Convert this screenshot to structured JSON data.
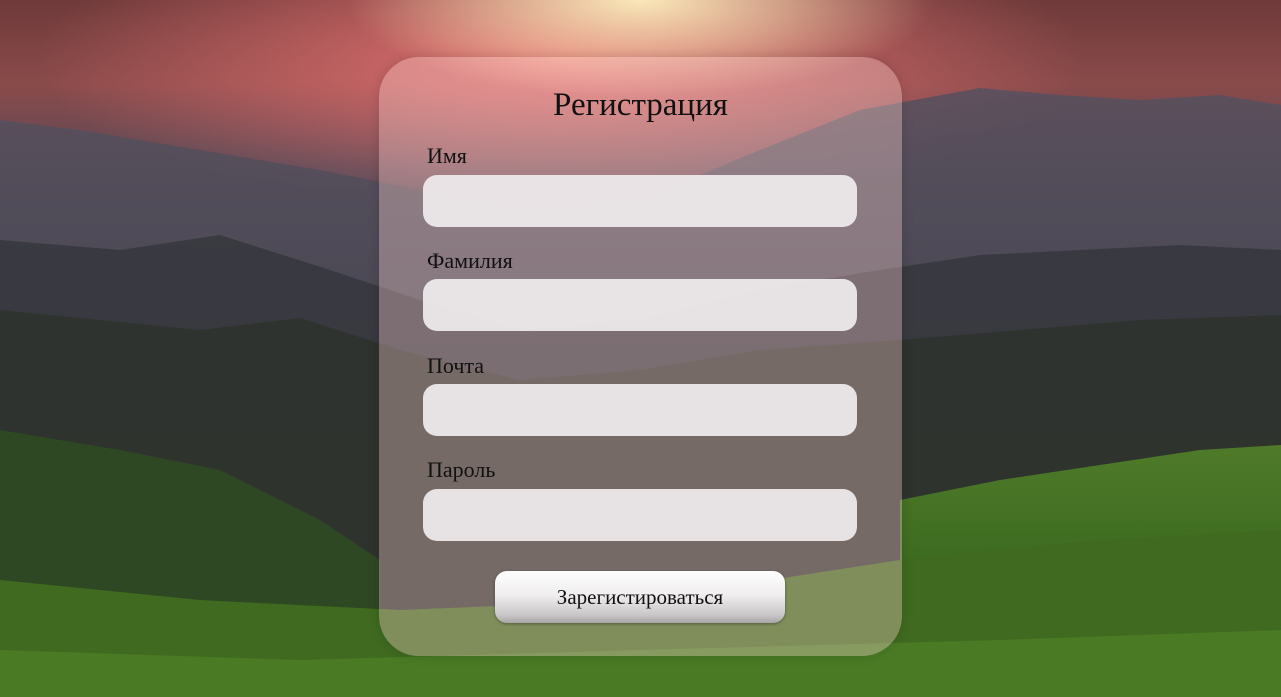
{
  "form": {
    "title": "Регистрация",
    "fields": [
      {
        "label": "Имя",
        "value": ""
      },
      {
        "label": "Фамилия",
        "value": ""
      },
      {
        "label": "Почта",
        "value": ""
      },
      {
        "label": "Пароль",
        "value": ""
      }
    ],
    "submit_label": "Зарегистироваться"
  },
  "colors": {
    "card_tint": "#ffd7d2",
    "input_bg": "#eeeaeb",
    "text": "#111111"
  }
}
